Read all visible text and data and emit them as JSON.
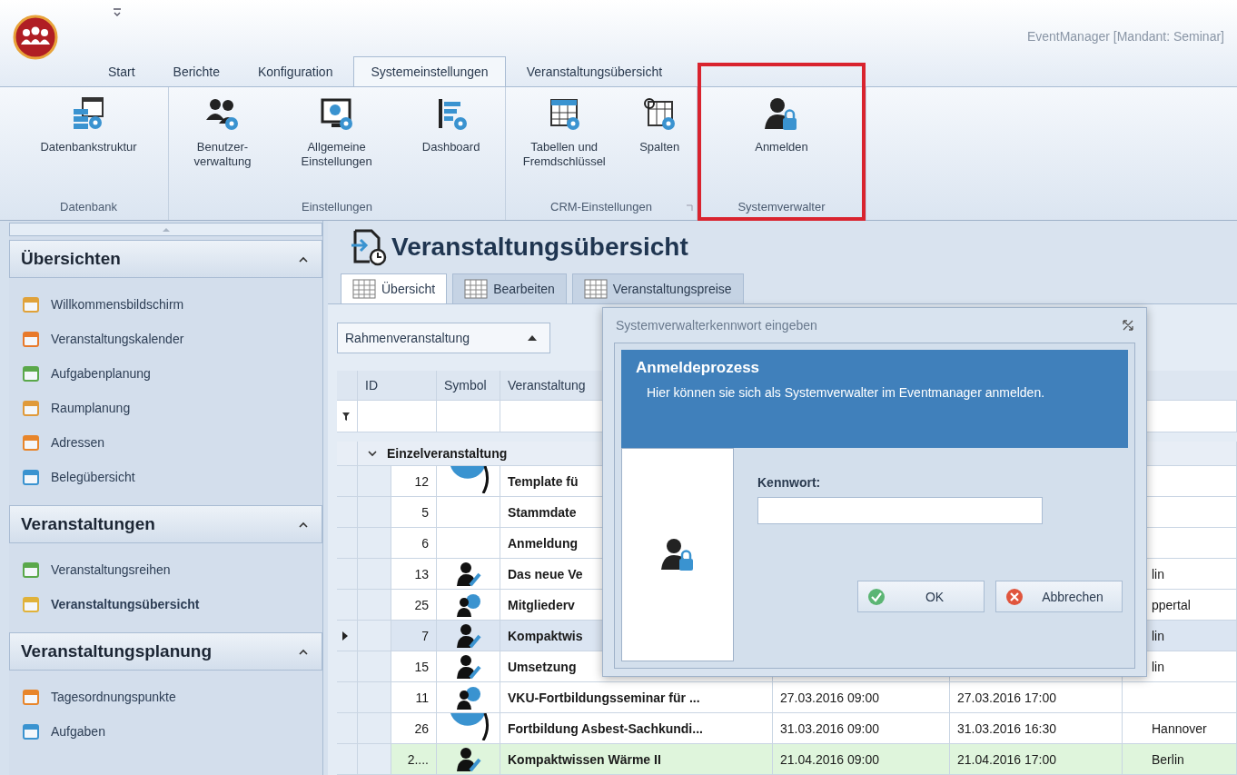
{
  "app": {
    "title": "EventManager [Mandant: Seminar]"
  },
  "ribbon": {
    "tabs": [
      {
        "label": "Start",
        "selected": false
      },
      {
        "label": "Berichte",
        "selected": false
      },
      {
        "label": "Konfiguration",
        "selected": false
      },
      {
        "label": "Systemeinstellungen",
        "selected": true
      },
      {
        "label": "Veranstaltungsübersicht",
        "selected": false
      }
    ],
    "groups": [
      {
        "label": "Datenbank",
        "highlighted": false,
        "dialog_launcher": false,
        "buttons": [
          {
            "label": "Datenbankstruktur"
          }
        ]
      },
      {
        "label": "Einstellungen",
        "highlighted": false,
        "dialog_launcher": false,
        "buttons": [
          {
            "label": "Benutzer-\nverwaltung"
          },
          {
            "label": "Allgemeine\nEinstellungen"
          },
          {
            "label": "Dashboard"
          }
        ]
      },
      {
        "label": "CRM-Einstellungen",
        "highlighted": false,
        "dialog_launcher": true,
        "buttons": [
          {
            "label": "Tabellen und\nFremdschlüssel"
          },
          {
            "label": "Spalten"
          }
        ]
      },
      {
        "label": "Systemverwalter",
        "highlighted": true,
        "dialog_launcher": false,
        "buttons": [
          {
            "label": "Anmelden"
          }
        ]
      }
    ]
  },
  "sidebar": {
    "sections": [
      {
        "title": "Übersichten",
        "expanded": true,
        "items": [
          {
            "label": "Willkommensbildschirm",
            "selected": false
          },
          {
            "label": "Veranstaltungskalender",
            "selected": false
          },
          {
            "label": "Aufgabenplanung",
            "selected": false
          },
          {
            "label": "Raumplanung",
            "selected": false
          },
          {
            "label": "Adressen",
            "selected": false
          },
          {
            "label": "Belegübersicht",
            "selected": false
          }
        ]
      },
      {
        "title": "Veranstaltungen",
        "expanded": true,
        "items": [
          {
            "label": "Veranstaltungsreihen",
            "selected": false
          },
          {
            "label": "Veranstaltungsübersicht",
            "selected": true
          }
        ]
      },
      {
        "title": "Veranstaltungsplanung",
        "expanded": true,
        "items": [
          {
            "label": "Tagesordnungspunkte",
            "selected": false
          },
          {
            "label": "Aufgaben",
            "selected": false
          }
        ]
      }
    ]
  },
  "view": {
    "title": "Veranstaltungsübersicht",
    "tabs": [
      {
        "label": "Übersicht",
        "selected": true
      },
      {
        "label": "Bearbeiten",
        "selected": false
      },
      {
        "label": "Veranstaltungspreise",
        "selected": false
      }
    ],
    "filter": {
      "value": "Rahmenveranstaltung"
    },
    "grid": {
      "columns": [
        "ID",
        "Symbol",
        "Veranstaltung"
      ],
      "group": {
        "label": "Einzelveranstaltung",
        "expanded": true
      },
      "rows": [
        {
          "id": "12",
          "kind": "disc",
          "name": "Template fü",
          "selected": false,
          "highlighted": false
        },
        {
          "id": "5",
          "kind": "none",
          "name": "Stammdate",
          "selected": false,
          "highlighted": false
        },
        {
          "id": "6",
          "kind": "none",
          "name": "Anmeldung",
          "selected": false,
          "highlighted": false
        },
        {
          "id": "13",
          "kind": "user-edit",
          "name": "Das neue Ve",
          "location": "lin",
          "selected": false,
          "highlighted": false
        },
        {
          "id": "25",
          "kind": "user-globe",
          "name": "Mitgliederv",
          "location": "ppertal",
          "selected": false,
          "highlighted": false
        },
        {
          "id": "7",
          "kind": "user-edit",
          "name": "Kompaktwis",
          "location": "lin",
          "selected": true,
          "highlighted": false
        },
        {
          "id": "15",
          "kind": "user-edit",
          "name": "Umsetzung",
          "location": "lin",
          "selected": false,
          "highlighted": false
        },
        {
          "id": "11",
          "kind": "user-globe",
          "name": "VKU-Fortbildungsseminar für ...",
          "start": "27.03.2016 09:00",
          "end": "27.03.2016 17:00",
          "selected": false,
          "highlighted": false
        },
        {
          "id": "26",
          "kind": "disc",
          "name": "Fortbildung Asbest-Sachkundi...",
          "start": "31.03.2016 09:00",
          "end": "31.03.2016 16:30",
          "location": "Hannover",
          "selected": false,
          "highlighted": false
        },
        {
          "id": "2....",
          "kind": "user-edit",
          "name": "Kompaktwissen Wärme II",
          "start": "21.04.2016 09:00",
          "end": "21.04.2016 17:00",
          "location": "Berlin",
          "selected": false,
          "highlighted": true
        }
      ]
    }
  },
  "dialog": {
    "title": "Systemverwalterkennwort eingeben",
    "heading": "Anmeldeprozess",
    "description": "Hier können sie sich als Systemverwalter im Eventmanager anmelden.",
    "field_label": "Kennwort:",
    "buttons": [
      {
        "label": "OK",
        "kind": "ok"
      },
      {
        "label": "Abbrechen",
        "kind": "cancel"
      }
    ]
  }
}
